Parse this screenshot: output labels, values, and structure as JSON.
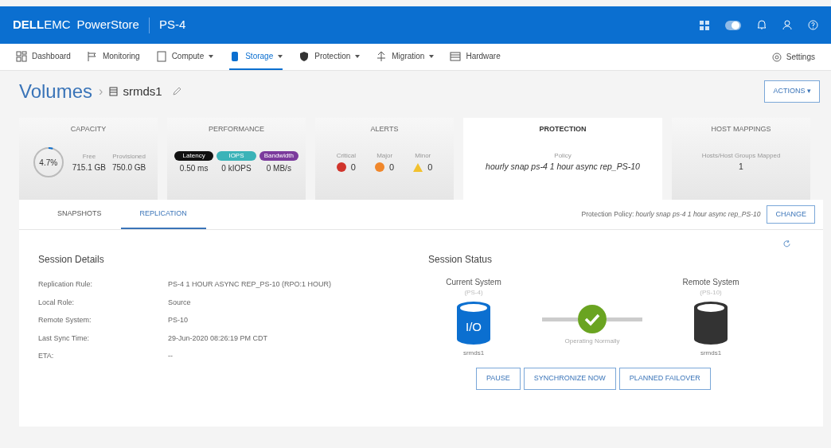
{
  "header": {
    "brand_bold": "DELL",
    "brand_light": "EMC",
    "product": "PowerStore",
    "system": "PS-4"
  },
  "nav": {
    "items": [
      {
        "label": "Dashboard",
        "kind": "dashboard",
        "has_menu": false,
        "selected": false
      },
      {
        "label": "Monitoring",
        "kind": "flag",
        "has_menu": false,
        "selected": false
      },
      {
        "label": "Compute",
        "kind": "compute",
        "has_menu": true,
        "selected": false
      },
      {
        "label": "Storage",
        "kind": "storage",
        "has_menu": true,
        "selected": true
      },
      {
        "label": "Protection",
        "kind": "shield",
        "has_menu": true,
        "selected": false
      },
      {
        "label": "Migration",
        "kind": "migration",
        "has_menu": true,
        "selected": false
      },
      {
        "label": "Hardware",
        "kind": "hardware",
        "has_menu": false,
        "selected": false
      }
    ],
    "settings": "Settings"
  },
  "breadcrumb": {
    "parent": "Volumes",
    "separator": "›",
    "current": "srmds1"
  },
  "actions_button": "ACTIONS ▾",
  "cards": [
    {
      "kind": "capacity",
      "title": "CAPACITY",
      "selected": false,
      "percent": "4.7%",
      "level": 0.047,
      "free_label": "Free",
      "free": "715.1 GB",
      "provisioned_label": "Provisioned",
      "provisioned": "750.0 GB"
    },
    {
      "kind": "performance",
      "title": "PERFORMANCE",
      "selected": false,
      "metrics": [
        {
          "badge": "Latency",
          "color": "#111111",
          "value": "0.50 ms"
        },
        {
          "badge": "IOPS",
          "color": "#3bb3b8",
          "value": "0 kIOPS"
        },
        {
          "badge": "Bandwidth",
          "color": "#7b3a9c",
          "value": "0 MB/s"
        }
      ]
    },
    {
      "kind": "alerts",
      "title": "ALERTS",
      "selected": false,
      "alerts": [
        {
          "label": "Critical",
          "kind": "critical",
          "count": "0"
        },
        {
          "label": "Major",
          "kind": "major",
          "count": "0"
        },
        {
          "label": "Minor",
          "kind": "minor",
          "count": "0"
        }
      ]
    },
    {
      "kind": "protection",
      "title": "PROTECTION",
      "selected": true,
      "label": "Policy",
      "value": "hourly snap ps-4 1 hour async rep_PS-10"
    },
    {
      "kind": "hosts",
      "title": "HOST MAPPINGS",
      "selected": false,
      "label": "Hosts/Host Groups Mapped",
      "value": "1"
    }
  ],
  "tabs": [
    {
      "label": "SNAPSHOTS",
      "selected": false
    },
    {
      "label": "REPLICATION",
      "selected": true
    }
  ],
  "policy_line": "Protection Policy: *hourly snap ps-4 1 hour async rep_PS-10*",
  "change_button": "CHANGE",
  "session_details": {
    "title": "Session Details",
    "rows": [
      {
        "label": "Replication Rule:",
        "value": "PS-4 1 HOUR ASYNC REP_PS-10 (RPO:1 HOUR)"
      },
      {
        "label": "Local Role:",
        "value": "Source"
      },
      {
        "label": "Remote System:",
        "value": "PS-10"
      },
      {
        "label": "Last Sync Time:",
        "value": "29-Jun-2020 08:26:19 PM CDT"
      },
      {
        "label": "ETA:",
        "value": "--"
      }
    ]
  },
  "session_status": {
    "title": "Session Status",
    "current": {
      "title": "Current System",
      "system": "(PS-4)",
      "icon_text": "I/O",
      "volume": "srmds1"
    },
    "remote": {
      "title": "Remote System",
      "system": "(PS-10)",
      "volume": "srmds1"
    },
    "status": "Operating Normally",
    "buttons": [
      "PAUSE",
      "SYNCHRONIZE NOW",
      "PLANNED FAILOVER"
    ]
  }
}
